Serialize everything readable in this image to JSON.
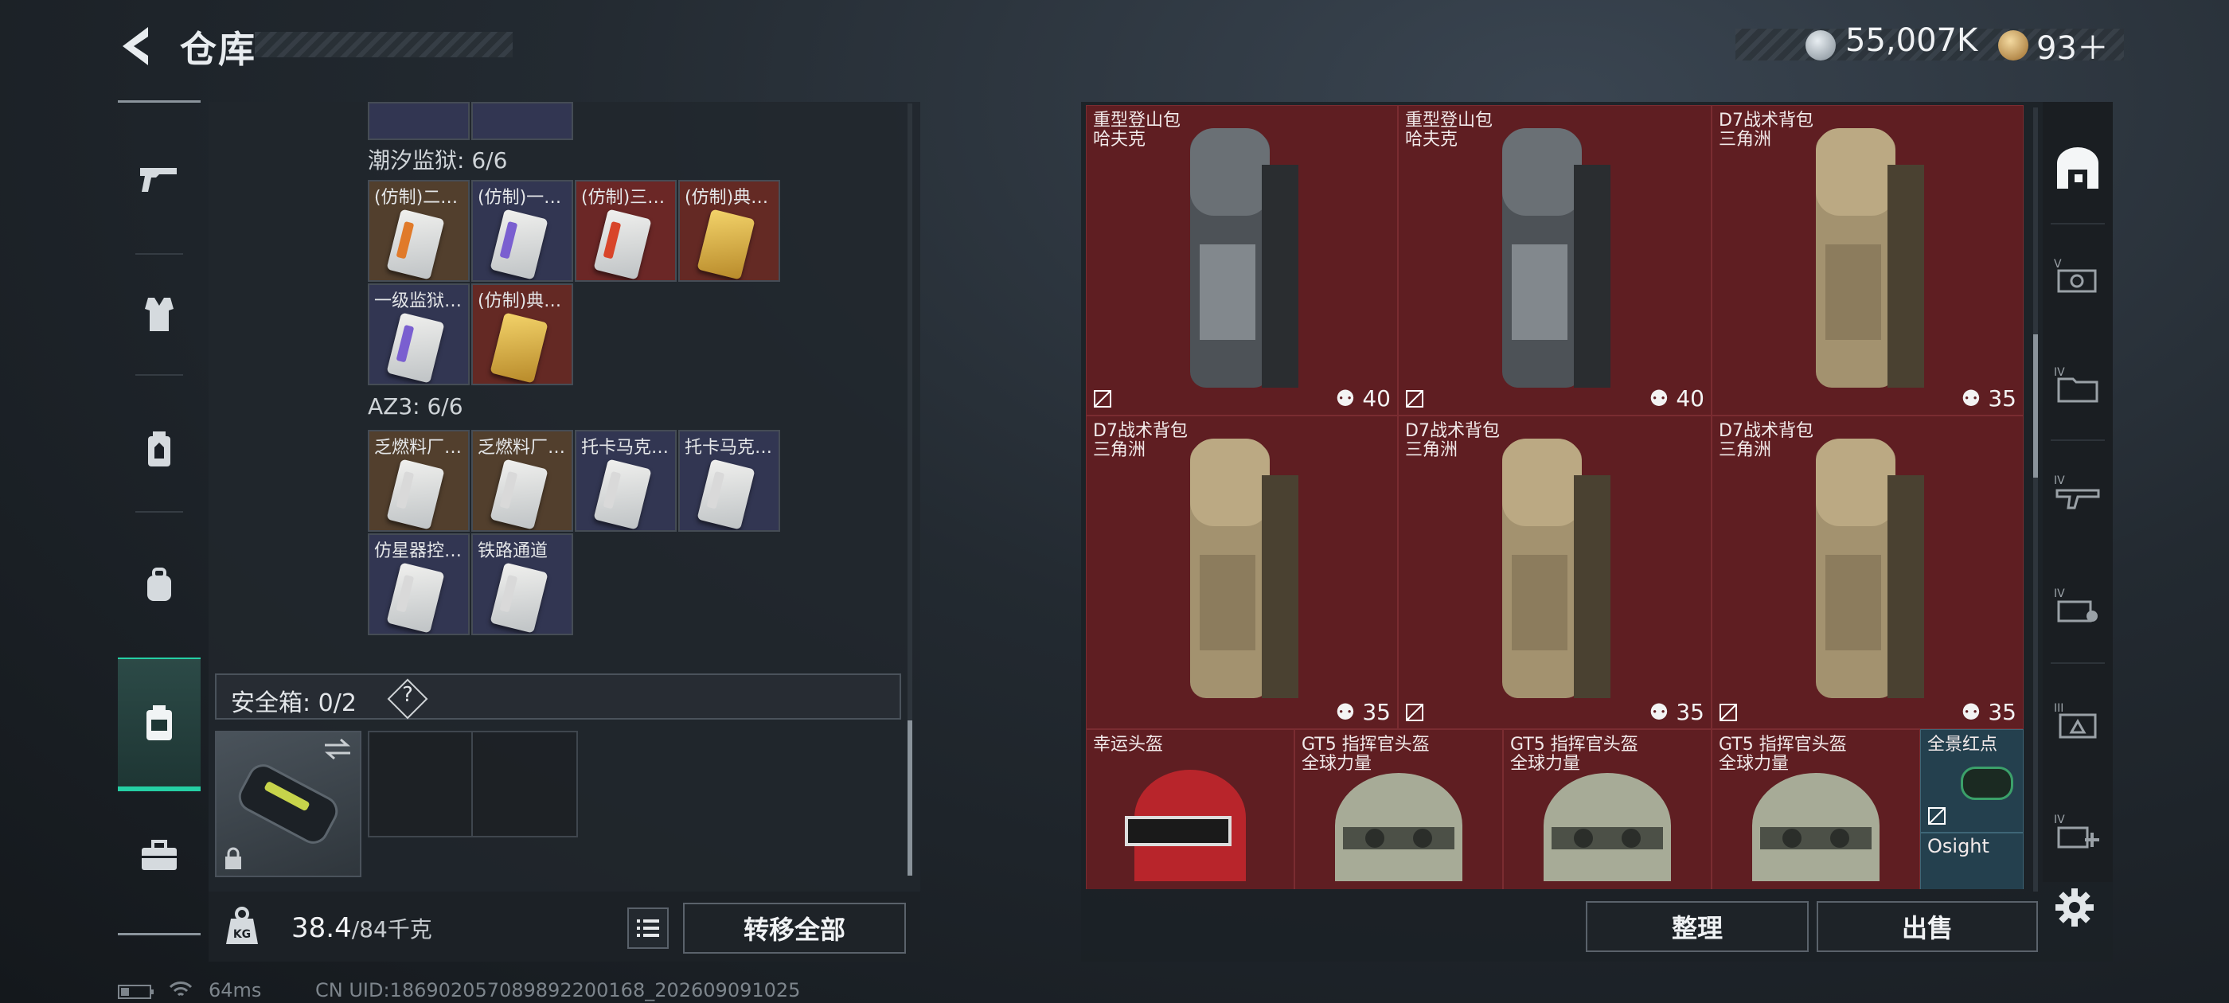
{
  "header": {
    "title": "仓库",
    "currency1": "55,007K",
    "currency2": "93＋"
  },
  "left_sections": [
    {
      "label": "潮汐监狱: 6/6",
      "items": [
        "(仿制)二…",
        "(仿制)一…",
        "(仿制)三…",
        "(仿制)典…",
        "一级监狱…",
        "(仿制)典…"
      ]
    },
    {
      "label": "AZ3: 6/6",
      "items": [
        "乏燃料厂…",
        "乏燃料厂…",
        "托卡马克…",
        "托卡马克…",
        "仿星器控…",
        "铁路通道"
      ]
    }
  ],
  "safe_box": {
    "label": "安全箱: 0/2",
    "help": "?"
  },
  "bottom": {
    "weight_value": "38.4",
    "weight_max": "/84千克",
    "transfer_all": "转移全部"
  },
  "right_items": [
    {
      "name": "重型登山包",
      "sub": "哈夫克",
      "count": "40"
    },
    {
      "name": "重型登山包",
      "sub": "哈夫克",
      "count": "40"
    },
    {
      "name": "D7战术背包",
      "sub": "三角洲",
      "count": "35"
    },
    {
      "name": "D7战术背包",
      "sub": "三角洲",
      "count": "35"
    },
    {
      "name": "D7战术背包",
      "sub": "三角洲",
      "count": "35"
    },
    {
      "name": "D7战术背包",
      "sub": "三角洲",
      "count": "35"
    },
    {
      "name": "幸运头盔",
      "sub": "",
      "count": ""
    },
    {
      "name": "GT5 指挥官头盔",
      "sub": "全球力量",
      "count": ""
    },
    {
      "name": "GT5 指挥官头盔",
      "sub": "全球力量",
      "count": ""
    },
    {
      "name": "GT5 指挥官头盔",
      "sub": "全球力量",
      "count": ""
    },
    {
      "name": "全景红点",
      "sub": "",
      "count": ""
    },
    {
      "name": "Osight",
      "sub": "",
      "count": ""
    }
  ],
  "right_buttons": {
    "sort": "整理",
    "sell": "出售"
  },
  "right_tabs": [
    "",
    "V",
    "IV",
    "IV",
    "IV",
    "III",
    "IV"
  ],
  "status": {
    "ping": "64ms",
    "uid": "CN UID:1869020570898922001​68_202609091025"
  },
  "colors": {
    "accent": "#25d0a5",
    "item_bg_red": "#5f1e22",
    "item_bg_blue": "#24404e"
  }
}
